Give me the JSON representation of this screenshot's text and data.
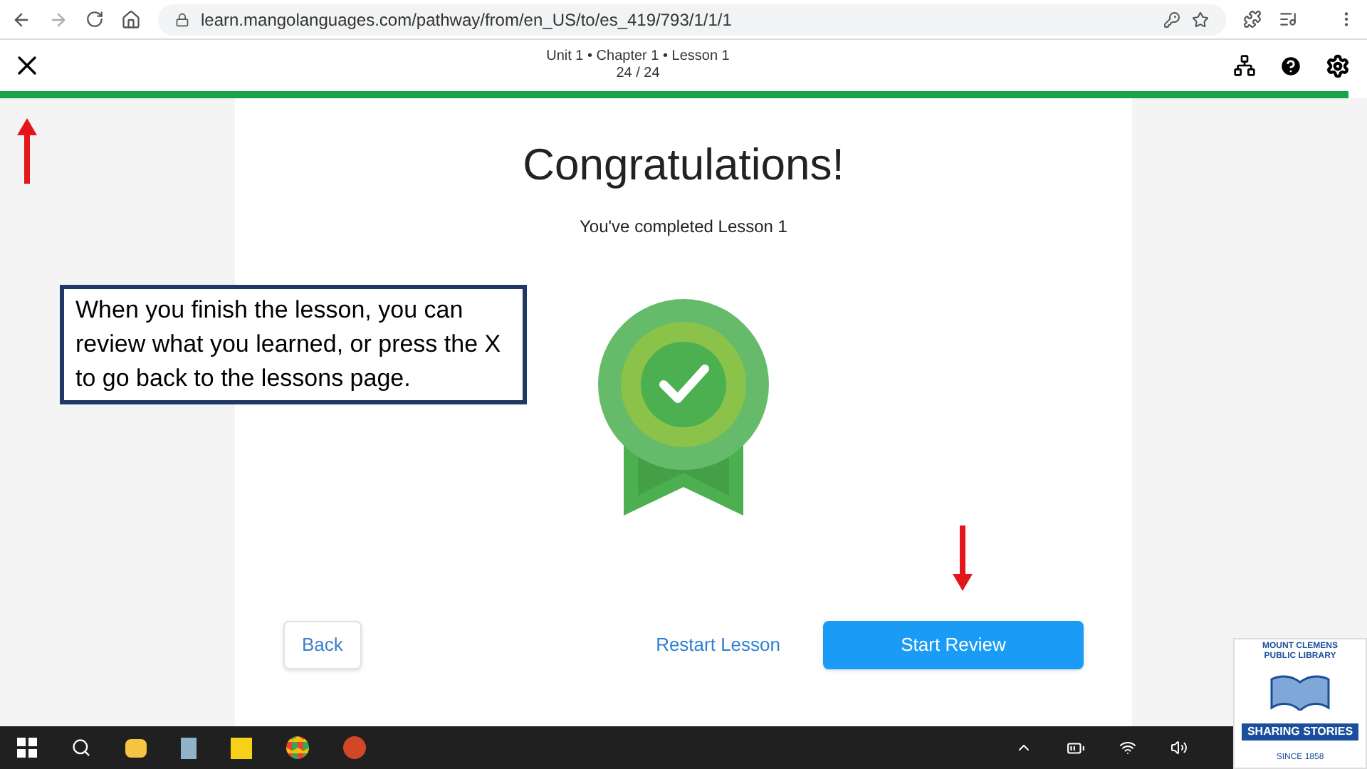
{
  "browser": {
    "url": "learn.mangolanguages.com/pathway/from/en_US/to/es_419/793/1/1/1"
  },
  "header": {
    "breadcrumb": "Unit 1 • Chapter 1 • Lesson 1",
    "counter": "24 / 24",
    "progress": {
      "level": 1
    }
  },
  "content": {
    "title": "Congratulations!",
    "subtitle": "You've completed Lesson 1",
    "buttons": [
      {
        "label": "Back",
        "kind": "outline"
      },
      {
        "label": "Restart Lesson",
        "kind": "link"
      },
      {
        "label": "Start Review",
        "kind": "primary"
      }
    ]
  },
  "annotation": {
    "text": "When you finish the lesson, you can review what you learned, or press the X to go back to the lessons page."
  },
  "logo": {
    "arc_text": "MOUNT CLEMENS PUBLIC LIBRARY",
    "banner": "SHARING STORIES",
    "since": "SINCE 1858"
  }
}
